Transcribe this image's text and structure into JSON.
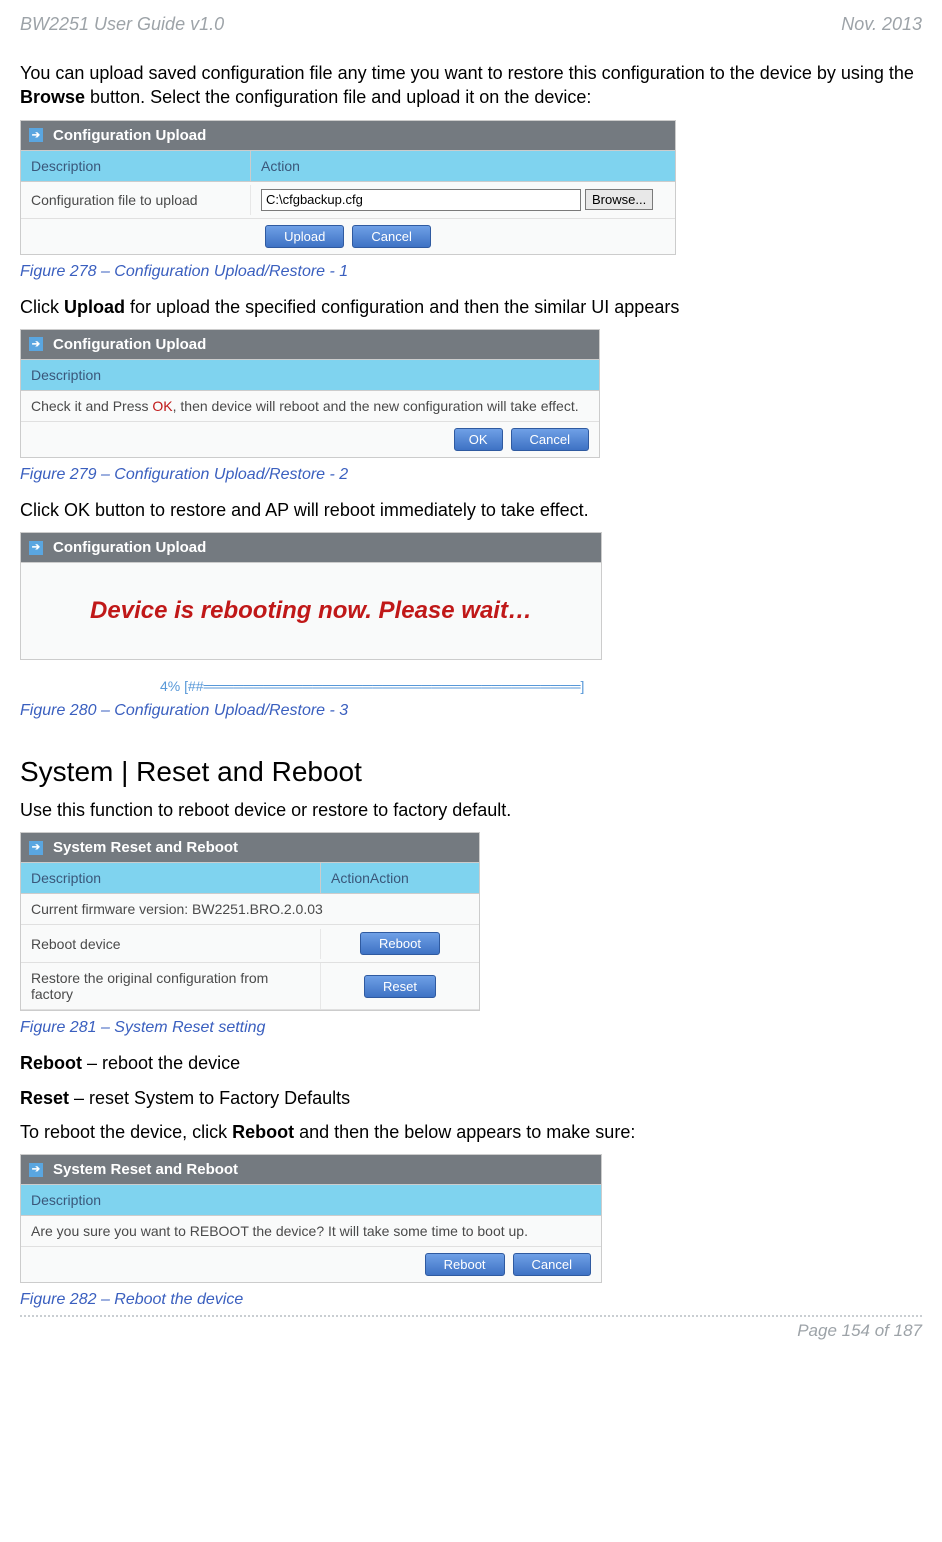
{
  "header": {
    "left": "BW2251 User Guide v1.0",
    "right": "Nov.  2013"
  },
  "intro": {
    "line1a": "You can upload saved configuration file any time you want to restore this configuration to the device by using the ",
    "line1b": "Browse",
    "line1c": " button. Select the configuration file and upload it on the device:"
  },
  "panel1": {
    "title": "Configuration Upload",
    "h1": "Description",
    "h2": "Action",
    "r1c1": "Configuration file to upload",
    "input_value": "C:\\cfgbackup.cfg",
    "browse": "Browse...",
    "upload": "Upload",
    "cancel": "Cancel"
  },
  "caption1": "Figure 278 – Configuration Upload/Restore - 1",
  "between1": {
    "a": "Click ",
    "b": "Upload",
    "c": " for upload the specified configuration and then the similar UI appears"
  },
  "panel2": {
    "title": "Configuration Upload",
    "h1": "Description",
    "msg_a": "Check it and Press ",
    "msg_ok": "OK",
    "msg_b": ", then device will reboot and the new configuration will take effect.",
    "ok": "OK",
    "cancel": "Cancel"
  },
  "caption2": "Figure 279 – Configuration Upload/Restore - 2",
  "between2": "Click OK button to restore and AP will reboot immediately to take effect.",
  "panel3": {
    "title": "Configuration Upload",
    "reboot_msg": "Device is rebooting now. Please wait…",
    "progress": "4% [##══════════════════════════════════════]"
  },
  "caption3": "Figure 280 – Configuration Upload/Restore - 3",
  "section_heading": "System | Reset and Reboot",
  "section_intro": "Use this function to reboot device or restore to factory default.",
  "panel4": {
    "title": "System Reset and Reboot",
    "h1": "Description",
    "h2": "ActionAction",
    "r1": "Current firmware version: BW2251.BRO.2.0.03",
    "r2": "Reboot device",
    "r3": "Restore the original configuration from factory",
    "reboot": "Reboot",
    "reset": "Reset"
  },
  "caption4": "Figure 281 – System Reset setting",
  "def1": {
    "a": "Reboot",
    "b": " – reboot the device"
  },
  "def2": {
    "a": "Reset",
    "b": " – reset System to Factory Defaults"
  },
  "between3": {
    "a": "To reboot the device, click ",
    "b": "Reboot",
    "c": " and then the below appears to make sure:"
  },
  "panel5": {
    "title": "System Reset and Reboot",
    "h1": "Description",
    "msg": "Are you sure you want to REBOOT the device? It will take some time to boot up.",
    "reboot": "Reboot",
    "cancel": "Cancel"
  },
  "caption5": "Figure 282 – Reboot the device",
  "footer": "Page 154 of 187"
}
